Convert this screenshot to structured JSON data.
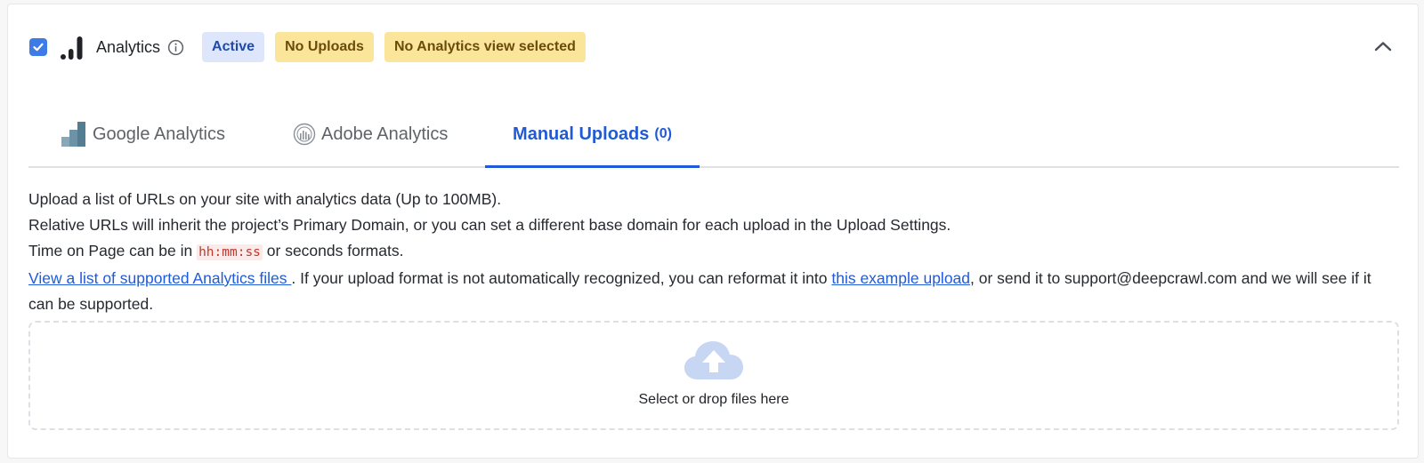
{
  "header": {
    "title": "Analytics",
    "checked": true,
    "badges": {
      "active": "Active",
      "no_uploads": "No Uploads",
      "no_view": "No Analytics view selected"
    }
  },
  "tabs": {
    "google": "Google Analytics",
    "adobe": "Adobe Analytics",
    "manual": "Manual Uploads",
    "manual_count": "(0)",
    "selected": "manual"
  },
  "description": {
    "line1": "Upload a list of URLs on your site with analytics data (Up to 100MB).",
    "line2": "Relative URLs will inherit the project’s Primary Domain, or you can set a different base domain for each upload in the Upload Settings.",
    "line3_pre": "Time on Page can be in ",
    "line3_code": "hh:mm:ss",
    "line3_post": " or seconds formats.",
    "link_supported": "View a list of supported Analytics files ",
    "line4_mid": ". If your upload format is not automatically recognized, you can reformat it into ",
    "link_example": "this example upload",
    "line4_post": ", or send it to support@deepcrawl.com and we will see if it can be supported."
  },
  "dropzone": {
    "label": "Select or drop files here"
  },
  "colors": {
    "accent": "#1f5bd8",
    "checkbox": "#3f7be7",
    "active_badge_bg": "#dde6fb",
    "warn_badge_bg": "#fbe59a"
  },
  "icons": {
    "checkbox": "check-icon",
    "analytics": "signal-bars-icon",
    "info": "info-icon",
    "collapse": "chevron-up-icon",
    "google": "google-analytics-icon",
    "adobe": "adobe-analytics-icon",
    "upload": "cloud-upload-icon"
  }
}
